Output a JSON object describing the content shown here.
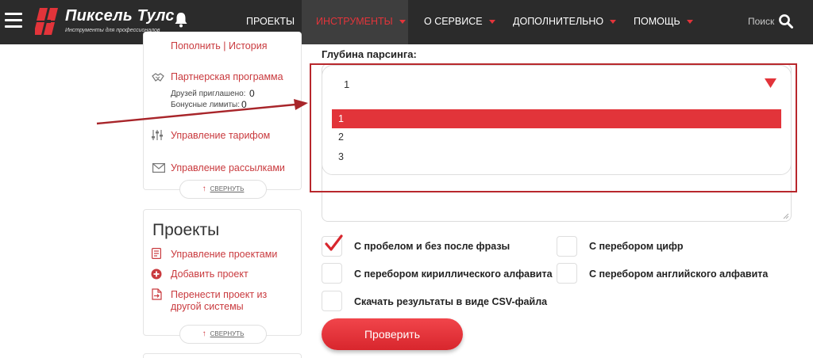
{
  "header": {
    "brand_name": "Пиксель Тулс",
    "brand_tagline": "Инструменты для профессионалов",
    "nav": [
      {
        "label": "ПРОЕКТЫ"
      },
      {
        "label": "ИНСТРУМЕНТЫ",
        "active": true
      },
      {
        "label": "О СЕРВИСЕ"
      },
      {
        "label": "ДОПОЛНИТЕЛЬНО"
      },
      {
        "label": "ПОМОЩЬ"
      }
    ],
    "search_label": "Поиск",
    "accent_color": "#e2343a"
  },
  "sidebar": {
    "balance_links": "Пополнить | История",
    "partner_link": "Партнерская программа",
    "friends_invited_label": "Друзей приглашено:",
    "friends_invited_value": "0",
    "bonus_limits_label": "Бонусные лимиты:",
    "bonus_limits_value": "0",
    "tariff_link": "Управление тарифом",
    "mailing_link": "Управление рассылками",
    "collapse_label": "СВЕРНУТЬ",
    "projects_title": "Проекты",
    "project_links": [
      {
        "label": "Управление проектами"
      },
      {
        "label": "Добавить проект"
      },
      {
        "label": "Перенести проект из другой системы"
      }
    ]
  },
  "form": {
    "depth_label": "Глубина парсинга:",
    "depth_selected": "1",
    "depth_options": [
      "1",
      "2",
      "3"
    ],
    "checkboxes": [
      {
        "label": "С пробелом и без после фразы",
        "checked": true
      },
      {
        "label": "С перебором цифр",
        "checked": false
      },
      {
        "label": "С перебором кириллического алфавита",
        "checked": false
      },
      {
        "label": "С перебором английского алфавита",
        "checked": false
      },
      {
        "label": "Скачать результаты в виде CSV-файла",
        "checked": false
      }
    ],
    "submit_label": "Проверить"
  }
}
